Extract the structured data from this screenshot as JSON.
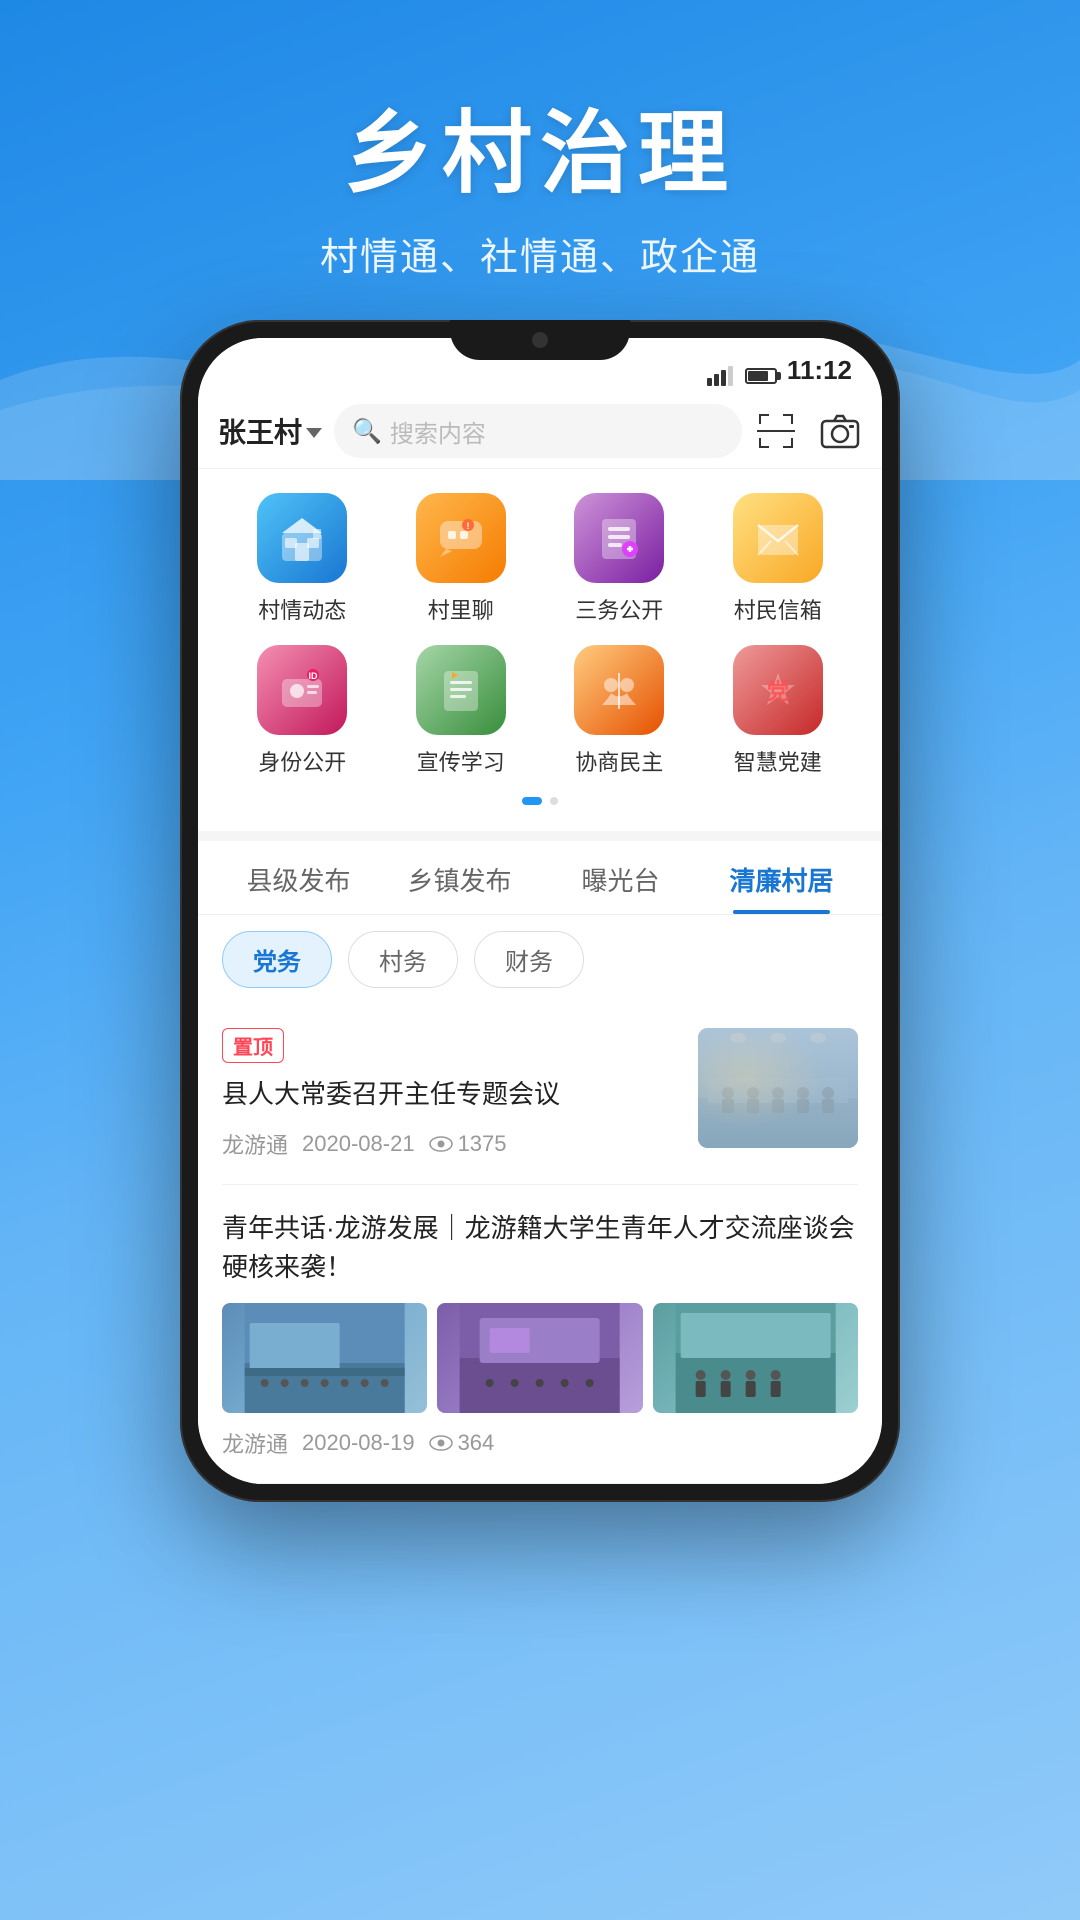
{
  "header": {
    "title": "乡村治理",
    "subtitle": "村情通、社情通、政企通"
  },
  "status_bar": {
    "time": "11:12",
    "signal": "signal",
    "battery": "battery"
  },
  "top_nav": {
    "village_name": "张王村",
    "dropdown_label": "dropdown",
    "search_placeholder": "搜索内容",
    "scan_label": "扫码",
    "camera_label": "拍照"
  },
  "app_grid": {
    "row1": [
      {
        "id": "village-dynamics",
        "label": "村情动态",
        "icon": "🏘",
        "color": "icon-blue"
      },
      {
        "id": "village-chat",
        "label": "村里聊",
        "icon": "💬",
        "color": "icon-orange"
      },
      {
        "id": "three-affairs",
        "label": "三务公开",
        "icon": "📋",
        "color": "icon-purple"
      },
      {
        "id": "villager-mailbox",
        "label": "村民信箱",
        "icon": "✉",
        "color": "icon-yellow"
      }
    ],
    "row2": [
      {
        "id": "identity-public",
        "label": "身份公开",
        "icon": "👤",
        "color": "icon-pink"
      },
      {
        "id": "publicity-study",
        "label": "宣传学习",
        "icon": "📄",
        "color": "icon-green"
      },
      {
        "id": "consultative-democracy",
        "label": "协商民主",
        "icon": "🤝",
        "color": "icon-amber"
      },
      {
        "id": "smart-party",
        "label": "智慧党建",
        "icon": "⚑",
        "color": "icon-red"
      }
    ],
    "page_dots": [
      "active",
      "inactive"
    ]
  },
  "tabs": [
    {
      "id": "county",
      "label": "县级发布",
      "active": false
    },
    {
      "id": "township",
      "label": "乡镇发布",
      "active": false
    },
    {
      "id": "exposure",
      "label": "曝光台",
      "active": false
    },
    {
      "id": "clean-village",
      "label": "清廉村居",
      "active": true
    }
  ],
  "filter_chips": [
    {
      "id": "party-affairs",
      "label": "党务",
      "active": true
    },
    {
      "id": "village-affairs",
      "label": "村务",
      "active": false
    },
    {
      "id": "finance",
      "label": "财务",
      "active": false
    }
  ],
  "news": {
    "items": [
      {
        "id": "news-1",
        "pinned": true,
        "pin_label": "置顶",
        "title": "县人大常委召开主任专题会议",
        "source": "龙游通",
        "date": "2020-08-21",
        "views": "1375",
        "has_thumb": true
      },
      {
        "id": "news-2",
        "pinned": false,
        "title": "青年共话·龙游发展｜龙游籍大学生青年人才交流座谈会硬核来袭！",
        "source": "龙游通",
        "date": "2020-08-19",
        "views": "364",
        "has_multi_thumb": true
      }
    ]
  }
}
